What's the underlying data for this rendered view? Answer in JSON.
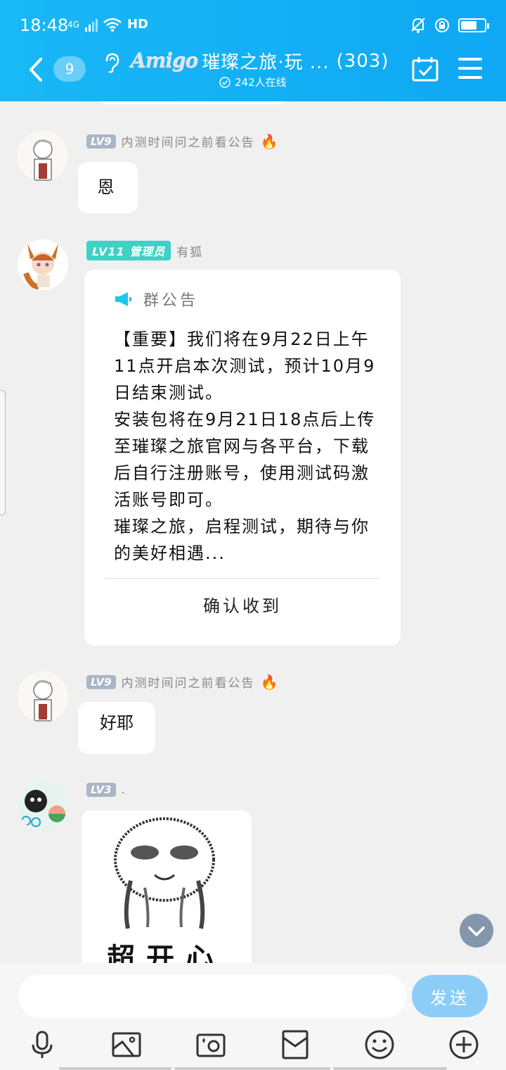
{
  "status_bar": {
    "time": "18:48",
    "network": "4G",
    "hd": "HD",
    "battery_level": 0.7
  },
  "header": {
    "unread_count": "9",
    "brand": "Amigo",
    "title": "璀璨之旅·玩 ...",
    "member_count": "(303)",
    "online": "242人在线"
  },
  "messages": [
    {
      "level": "LV9",
      "nickname": "内测时间问之前看公告",
      "badge_icon": "fire-icon",
      "text": "恩"
    },
    {
      "level": "LV11 管理员",
      "nickname": "有狐",
      "notice": {
        "title": "群公告",
        "paragraphs": [
          "【重要】我们将在9月22日上午11点开启本次测试，预计10月9日结束测试。",
          "安装包将在9月21日18点后上传至璀璨之旅官网与各平台，下载后自行注册账号，使用测试码激活账号即可。",
          "璀璨之旅，启程测试，期待与你的美好相遇..."
        ],
        "confirm_label": "确认收到"
      }
    },
    {
      "level": "LV9",
      "nickname": "内测时间问之前看公告",
      "badge_icon": "fire-icon",
      "text": "好耶"
    },
    {
      "level": "LV3",
      "nickname": ".",
      "sticker_text": "超开心"
    }
  ],
  "input": {
    "placeholder": "",
    "send_label": "发送"
  },
  "toolbar": [
    "microphone-icon",
    "image-icon",
    "camera-icon",
    "red-packet-icon",
    "emoji-icon",
    "plus-icon"
  ],
  "colors": {
    "header": "#19b8f6",
    "admin_badge": "#3fd1c5",
    "level_badge": "#a9b6c6",
    "send_button": "#8ccdf7"
  }
}
